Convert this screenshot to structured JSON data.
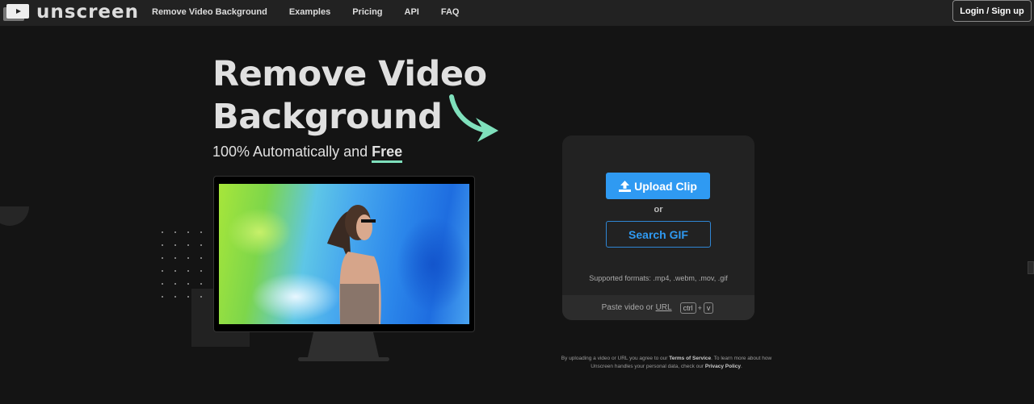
{
  "header": {
    "logo_text": "unscreen",
    "nav": [
      {
        "label": "Remove Video Background"
      },
      {
        "label": "Examples"
      },
      {
        "label": "Pricing"
      },
      {
        "label": "API"
      },
      {
        "label": "FAQ"
      }
    ],
    "login_label": "Login / Sign up"
  },
  "hero": {
    "title_line1": "Remove Video",
    "title_line2": "Background",
    "subtitle_prefix": "100% Automatically and ",
    "subtitle_highlight": "Free"
  },
  "upload_card": {
    "upload_label": "Upload Clip",
    "or_label": "or",
    "search_gif_label": "Search GIF",
    "formats": "Supported formats: .mp4, .webm, .mov, .gif",
    "paste_prefix": "Paste video or",
    "paste_url": "URL",
    "key_ctrl": "ctrl",
    "key_plus": "+",
    "key_v": "v"
  },
  "disclaimer": {
    "part1": "By uploading a video or URL you agree to our ",
    "terms": "Terms of Service",
    "part2": ". To learn more about how Unscreen handles your personal data, check our ",
    "privacy": "Privacy Policy",
    "part3": "."
  },
  "colors": {
    "accent_blue": "#2f9af2",
    "accent_green": "#7fe0bc",
    "background": "#141414",
    "topbar": "#222222"
  }
}
